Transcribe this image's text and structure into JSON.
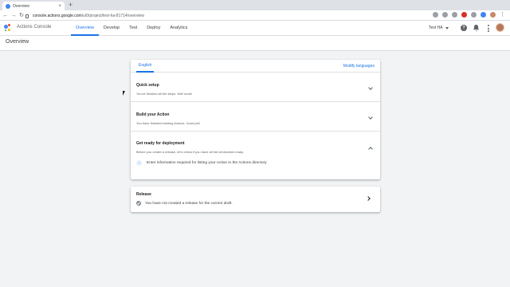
{
  "browser": {
    "tab_title": "Overview",
    "tab_close": "×",
    "new_tab": "+",
    "url_host": "console.actions.google.com",
    "url_path": "/u/0/project/test-ha-81714/overview"
  },
  "app": {
    "brand": "Actions Console",
    "nav": [
      "Overview",
      "Develop",
      "Test",
      "Deploy",
      "Analytics"
    ],
    "active_nav": "Overview",
    "project_name": "Test HA",
    "help_glyph": "?"
  },
  "page": {
    "title": "Overview"
  },
  "main_card": {
    "language_tab": "English",
    "modify_languages": "Modify languages",
    "sections": [
      {
        "title": "Quick setup",
        "subtitle": "You've finished all the steps. Well done!",
        "state": "collapsed"
      },
      {
        "title": "Build your Action",
        "subtitle": "You have finished building Actions. Good job!",
        "state": "collapsed"
      },
      {
        "title": "Get ready for deployment",
        "subtitle": "Before you create a release, let's check if you have all the information ready.",
        "state": "expanded"
      }
    ],
    "task": "Enter information required for listing your Action in the Actions directory",
    "task_glyph": "→"
  },
  "release_card": {
    "title": "Release",
    "message": "You have not created a release for the current draft."
  },
  "colors": {
    "accent": "#1a73e8",
    "page_bg": "#f1f3f4"
  },
  "icons": [
    "lock-icon",
    "help-icon",
    "bell-icon",
    "more-vert-icon",
    "chevron-down-icon",
    "chevron-up-icon",
    "arrow-forward-icon",
    "check-circle-icon",
    "chevron-right-icon"
  ]
}
